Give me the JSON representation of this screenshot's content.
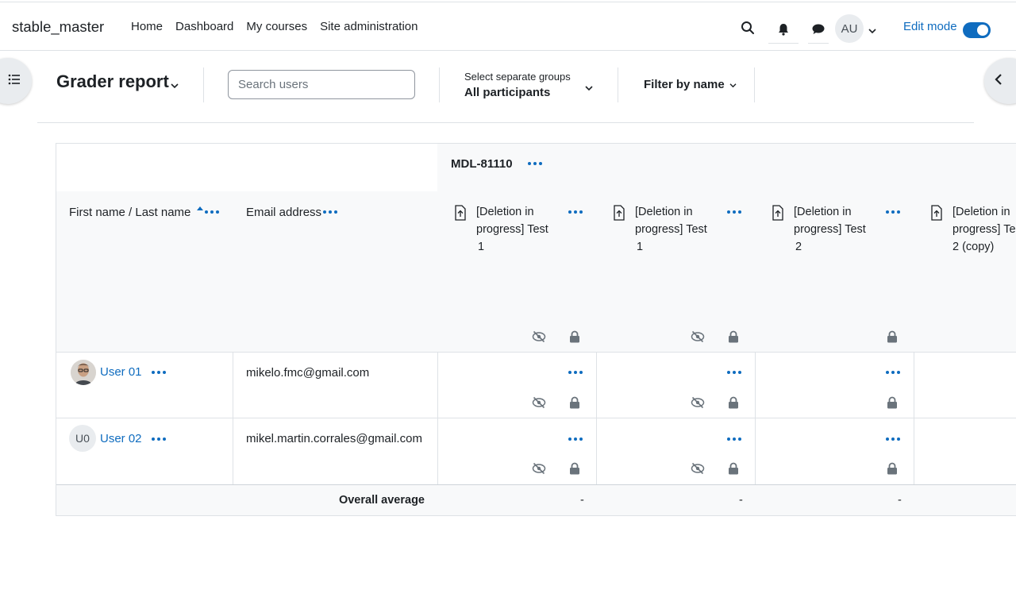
{
  "navbar": {
    "brand": "stable_master",
    "links": [
      "Home",
      "Dashboard",
      "My courses",
      "Site administration"
    ],
    "avatar_initials": "AU",
    "edit_mode_label": "Edit mode",
    "edit_mode_on": true
  },
  "header": {
    "title": "Grader report",
    "search_placeholder": "Search users",
    "groups_label": "Select separate groups",
    "groups_value": "All participants",
    "filter_label": "Filter by name"
  },
  "table": {
    "category": "MDL-81110",
    "col_name": "First name / Last name",
    "col_email": "Email address",
    "items": [
      {
        "line1": "[Deletion in",
        "line2": "progress] Test",
        "line3": "1",
        "hidden": true,
        "locked": true
      },
      {
        "line1": "[Deletion in",
        "line2": "progress] Test",
        "line3": "1",
        "hidden": true,
        "locked": true
      },
      {
        "line1": "[Deletion in",
        "line2": "progress] Test",
        "line3": "2",
        "hidden": false,
        "locked": true
      },
      {
        "line1": "[Deletion in",
        "line2": "progress] Te",
        "line3": "2 (copy)",
        "hidden": false,
        "locked": false
      }
    ],
    "rows": [
      {
        "name": "User 01",
        "email": "mikelo.fmc@gmail.com",
        "initials": ""
      },
      {
        "name": "User 02",
        "email": "mikel.martin.corrales@gmail.com",
        "initials": "U0"
      }
    ],
    "overall_label": "Overall average",
    "overall_values": [
      "-",
      "-",
      "-"
    ]
  },
  "colors": {
    "accent": "#0f6cbf",
    "border": "#dee2e6",
    "muted_icon": "#6a737b"
  }
}
